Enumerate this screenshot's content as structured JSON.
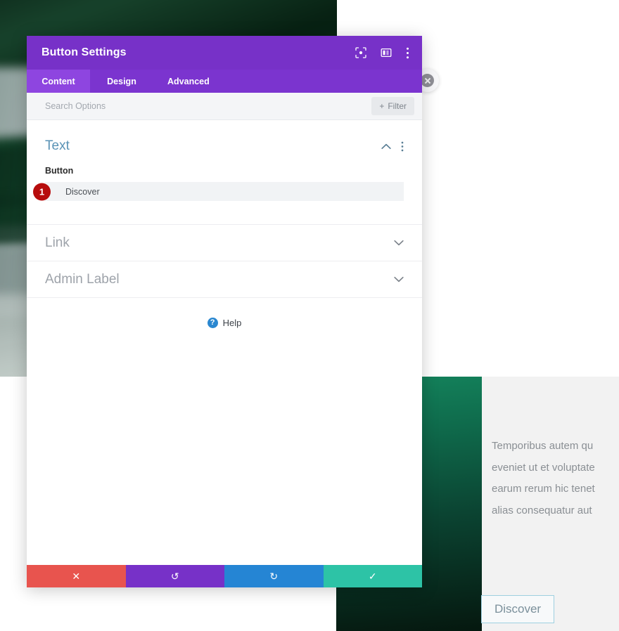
{
  "modal": {
    "title": "Button Settings",
    "header_icons": [
      {
        "name": "focus-icon"
      },
      {
        "name": "layout-columns-icon"
      },
      {
        "name": "more-vertical-icon"
      }
    ],
    "tabs": [
      {
        "label": "Content",
        "active": true
      },
      {
        "label": "Design",
        "active": false
      },
      {
        "label": "Advanced",
        "active": false
      }
    ],
    "search": {
      "placeholder": "Search Options",
      "value": "",
      "filter_label": "Filter",
      "filter_plus": "+"
    },
    "sections": [
      {
        "title": "Text",
        "state": "open",
        "field_label": "Button",
        "field_value": "Discover",
        "badge": "1"
      },
      {
        "title": "Link",
        "state": "collapsed"
      },
      {
        "title": "Admin Label",
        "state": "collapsed"
      }
    ],
    "help": {
      "label": "Help",
      "icon_glyph": "?"
    },
    "footer": [
      {
        "name": "cancel-button",
        "glyph": "✕",
        "color": "#e8544e"
      },
      {
        "name": "undo-button",
        "glyph": "↺",
        "color": "#7731c8"
      },
      {
        "name": "redo-button",
        "glyph": "↻",
        "color": "#2585d4"
      },
      {
        "name": "save-button",
        "glyph": "✓",
        "color": "#2dc3a6"
      }
    ]
  },
  "page": {
    "paragraph_lines": [
      "Temporibus autem qu",
      "eveniet ut et voluptate",
      "earum rerum hic tenet",
      "alias consequatur aut"
    ],
    "discover_button": "Discover"
  },
  "colors": {
    "header_purple": "#7731c8",
    "tab_bar_purple": "#7b34cf",
    "tab_active_purple": "#8e45e0",
    "section_title_blue": "#5a93b6",
    "badge_red": "#b70d0d",
    "help_blue": "#2a87d0"
  }
}
